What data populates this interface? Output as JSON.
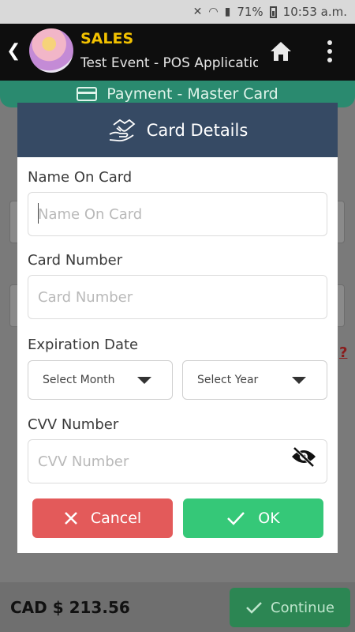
{
  "status_bar": {
    "battery": "71%",
    "time": "10:53 a.m."
  },
  "header": {
    "title": "SALES",
    "subtitle": "Test Event - POS Application",
    "icons": [
      "back-arrow-icon",
      "home-icon",
      "more-vert-icon"
    ]
  },
  "banner": {
    "label": "Payment - Master Card"
  },
  "background": {
    "q_link": "?"
  },
  "modal": {
    "title": "Card Details",
    "name_label": "Name On Card",
    "name_placeholder": "Name On Card",
    "number_label": "Card Number",
    "number_placeholder": "Card Number",
    "expiry_label": "Expiration Date",
    "month_select": "Select Month",
    "year_select": "Select Year",
    "cvv_label": "CVV Number",
    "cvv_placeholder": "CVV Number",
    "cancel_label": "Cancel",
    "ok_label": "OK"
  },
  "footer": {
    "total": "CAD $ 213.56",
    "continue_label": "Continue"
  },
  "colors": {
    "modal_header": "#364a64",
    "cancel": "#e35a5a",
    "ok": "#35c878",
    "title_yellow": "#f2c100",
    "banner_teal": "#2a8a6f"
  }
}
